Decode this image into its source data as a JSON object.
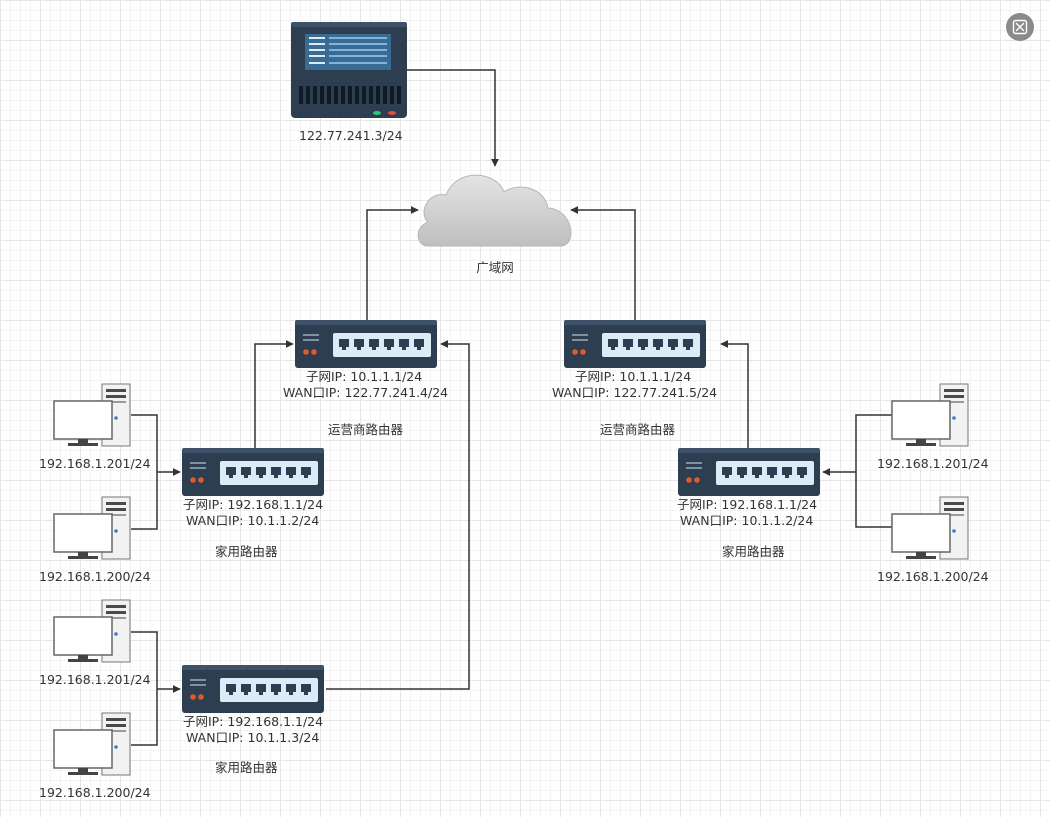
{
  "server": {
    "ip": "122.77.241.3/24"
  },
  "cloud": {
    "label": "广域网"
  },
  "isp_left": {
    "subnet": "子网IP:   10.1.1.1/24",
    "wan": "WAN口IP:  122.77.241.4/24",
    "label": "运营商路由器"
  },
  "isp_right": {
    "subnet": "子网IP:   10.1.1.1/24",
    "wan": "WAN口IP:  122.77.241.5/24",
    "label": "运营商路由器"
  },
  "home_a": {
    "subnet": "子网IP:   192.168.1.1/24",
    "wan": "WAN口IP:  10.1.1.2/24",
    "label": "家用路由器"
  },
  "home_b": {
    "subnet": "子网IP:   192.168.1.1/24",
    "wan": "WAN口IP:  10.1.1.3/24",
    "label": "家用路由器"
  },
  "home_c": {
    "subnet": "子网IP:   192.168.1.1/24",
    "wan": "WAN口IP:  10.1.1.2/24",
    "label": "家用路由器"
  },
  "pcs": {
    "a1": "192.168.1.201/24",
    "a2": "192.168.1.200/24",
    "b1": "192.168.1.201/24",
    "b2": "192.168.1.200/24",
    "c1": "192.168.1.201/24",
    "c2": "192.168.1.200/24"
  },
  "colors": {
    "device": "#2c3e50",
    "port": "#dcecf7",
    "cloud": "#d2d2d2",
    "line": "#333333"
  }
}
